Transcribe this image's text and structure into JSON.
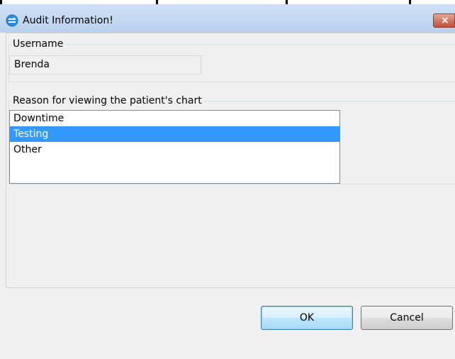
{
  "window": {
    "title": "Audit Information!",
    "close_glyph": "×",
    "close_color": "#c24f38",
    "titlebar_color": "#c4d8f1"
  },
  "username": {
    "legend": "Username",
    "value": "Brenda"
  },
  "reason": {
    "legend": "Reason for viewing the patient's chart",
    "items": [
      {
        "label": "Downtime",
        "selected": false
      },
      {
        "label": "Testing",
        "selected": true
      },
      {
        "label": "Other",
        "selected": false
      }
    ],
    "selection_color": "#3399ff"
  },
  "buttons": {
    "ok_label": "OK",
    "cancel_label": "Cancel"
  },
  "icons": {
    "app": "app-icon"
  }
}
